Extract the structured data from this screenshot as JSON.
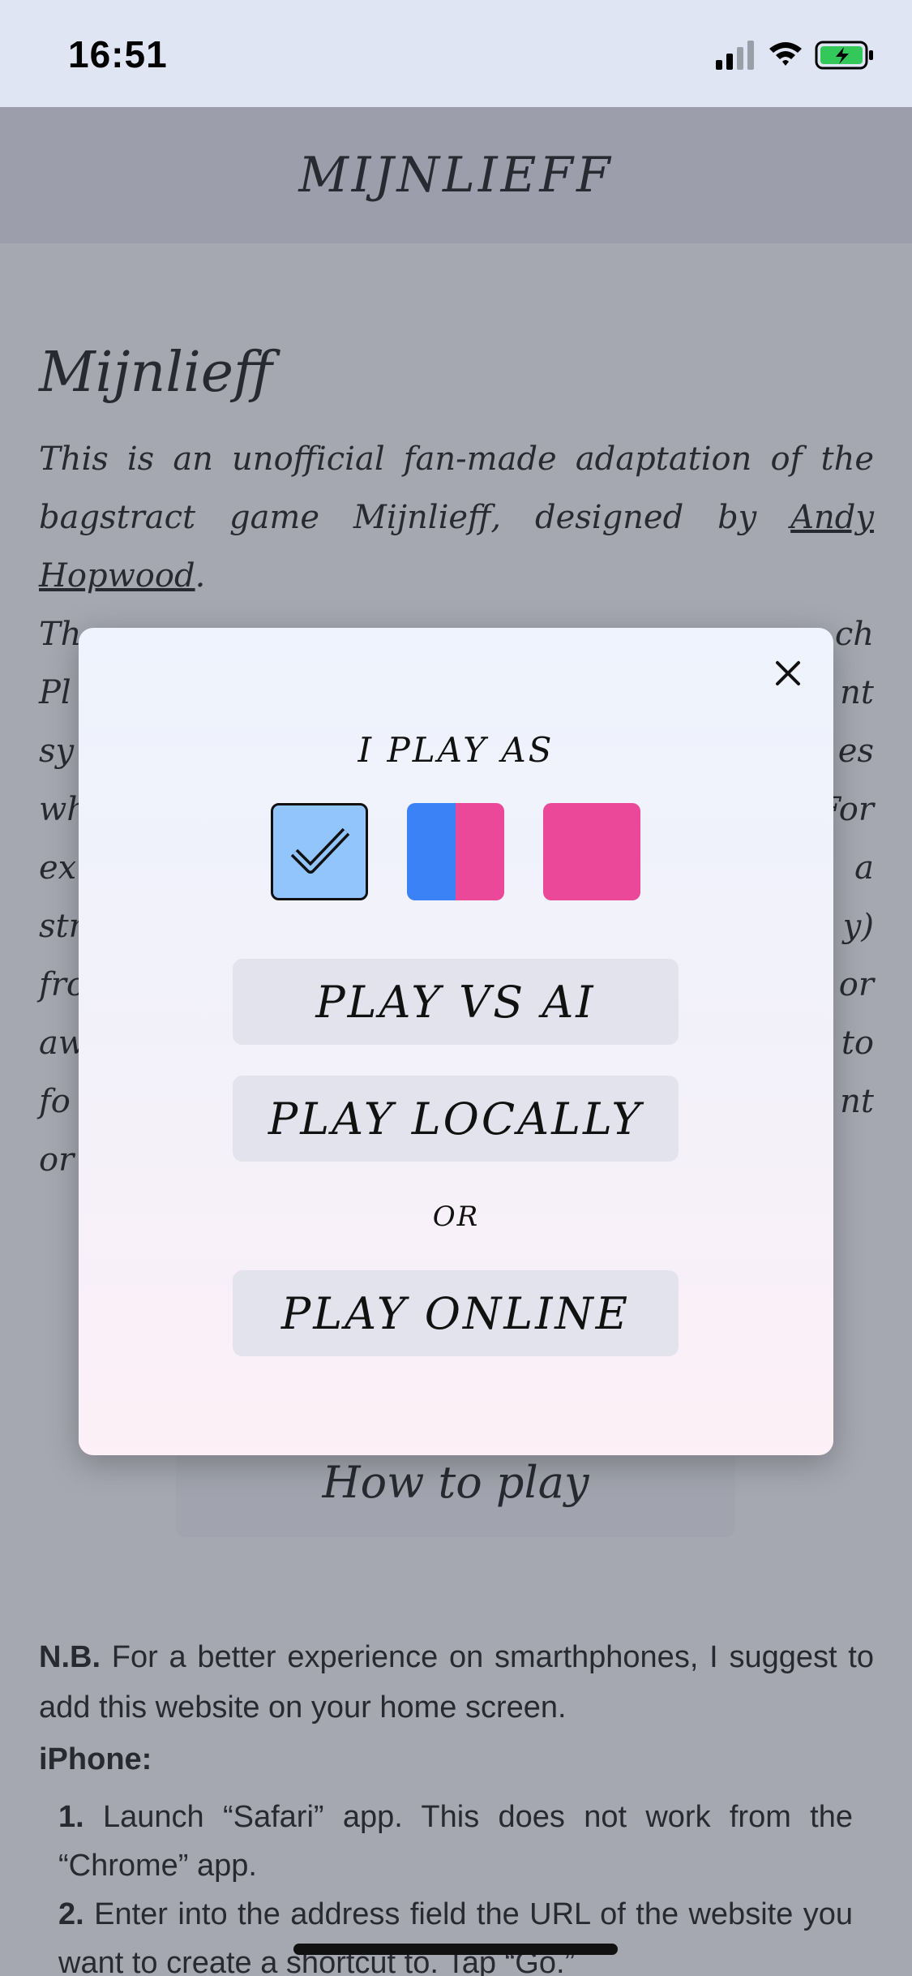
{
  "status_bar": {
    "time": "16:51"
  },
  "header": {
    "title": "MIJNLIEFF"
  },
  "page": {
    "title": "Mijnlieff",
    "intro_before_link": "This is an unofficial fan-made adaptation of the bagstract game Mijnlieff, designed by ",
    "author_link": "Andy Hopwood",
    "intro_after_link": ".",
    "rules_lines": [
      "Th",
      "Pl",
      "sy",
      "wh",
      "ex",
      "str",
      "fro",
      "aw",
      "fo",
      "or"
    ],
    "rules_tail_lines": [
      "ch",
      "nt",
      "es",
      "For",
      "a",
      "y)",
      "or",
      "to",
      "nt",
      ""
    ],
    "how_to_play": "How to play",
    "nb_label": "N.B.",
    "nb_text": " For a better experience on smarthphones, I suggest to add this website on your home screen.",
    "iphone_label": "iPhone:",
    "steps": [
      {
        "num": "1.",
        "text": " Launch “Safari” app. This does not work from the “Chrome” app."
      },
      {
        "num": "2.",
        "text": " Enter into the address field the URL of the website you want to create a shortcut to. Tap “Go.”"
      }
    ]
  },
  "modal": {
    "play_as_label": "I PLAY AS",
    "options": [
      {
        "name": "blue",
        "selected": true,
        "colors": [
          "#93c5fd"
        ]
      },
      {
        "name": "both",
        "selected": false,
        "colors": [
          "#3b82f6",
          "#ec4899"
        ]
      },
      {
        "name": "pink",
        "selected": false,
        "colors": [
          "#ec4899"
        ]
      }
    ],
    "play_vs_ai": "PLAY VS AI",
    "play_locally": "PLAY LOCALLY",
    "or_label": "OR",
    "play_online": "PLAY ONLINE"
  },
  "colors": {
    "blue": "#3b82f6",
    "light_blue": "#93c5fd",
    "pink": "#ec4899",
    "button_bg": "#e3e3ee"
  }
}
